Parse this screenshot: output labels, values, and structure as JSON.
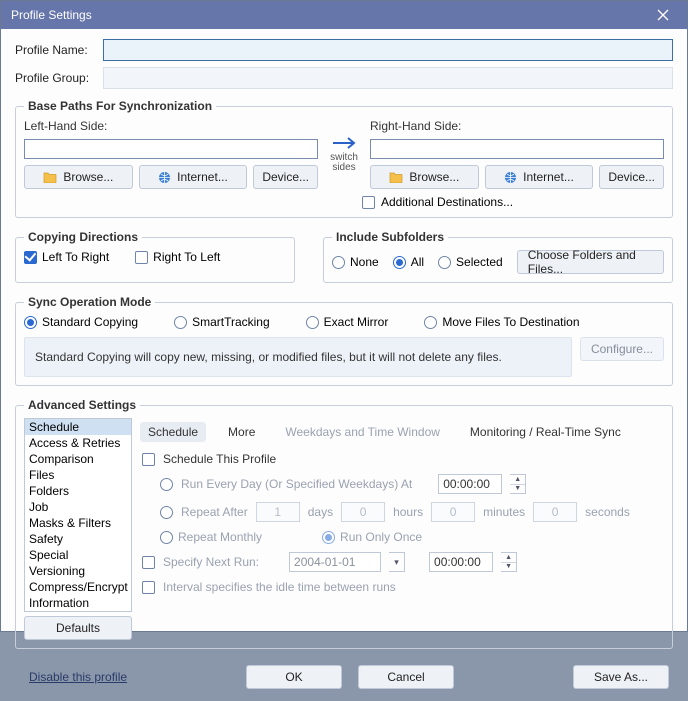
{
  "window_title": "Profile Settings",
  "profile_name_label": "Profile Name:",
  "profile_name_value": "",
  "profile_group_label": "Profile Group:",
  "profile_group_value": "",
  "base_paths": {
    "legend": "Base Paths For Synchronization",
    "left_label": "Left-Hand Side:",
    "right_label": "Right-Hand Side:",
    "left_value": "",
    "right_value": "",
    "browse": "Browse...",
    "internet": "Internet...",
    "device": "Device...",
    "switch": "switch sides",
    "additional": "Additional Destinations..."
  },
  "copying": {
    "legend": "Copying Directions",
    "ltr": "Left To Right",
    "rtl": "Right To Left"
  },
  "include": {
    "legend": "Include Subfolders",
    "none": "None",
    "all": "All",
    "selected": "Selected",
    "choose": "Choose Folders and Files..."
  },
  "sync": {
    "legend": "Sync Operation Mode",
    "standard": "Standard Copying",
    "smart": "SmartTracking",
    "exact": "Exact Mirror",
    "move": "Move Files To Destination",
    "desc": "Standard Copying will copy new, missing, or modified files, but it will not delete any files.",
    "configure": "Configure..."
  },
  "advanced": {
    "legend": "Advanced Settings",
    "items": [
      "Schedule",
      "Access & Retries",
      "Comparison",
      "Files",
      "Folders",
      "Job",
      "Masks & Filters",
      "Safety",
      "Special",
      "Versioning",
      "Compress/Encrypt",
      "Information"
    ],
    "defaults": "Defaults"
  },
  "tabs": {
    "schedule": "Schedule",
    "more": "More",
    "weekdays": "Weekdays and Time Window",
    "monitoring": "Monitoring / Real-Time Sync"
  },
  "schedule": {
    "title": "Schedule This Profile",
    "run_every": "Run Every Day (Or Specified Weekdays) At",
    "time1": "00:00:00",
    "repeat_after": "Repeat After",
    "days_v": "1",
    "days_l": "days",
    "hours_v": "0",
    "hours_l": "hours",
    "minutes_v": "0",
    "minutes_l": "minutes",
    "seconds_v": "0",
    "seconds_l": "seconds",
    "repeat_monthly": "Repeat Monthly",
    "run_once": "Run Only Once",
    "specify_next": "Specify Next Run:",
    "date": "2004-01-01",
    "time2": "00:00:00",
    "idle": "Interval specifies the idle time between runs"
  },
  "footer": {
    "disable": "Disable this profile",
    "ok": "OK",
    "cancel": "Cancel",
    "save_as": "Save As..."
  }
}
